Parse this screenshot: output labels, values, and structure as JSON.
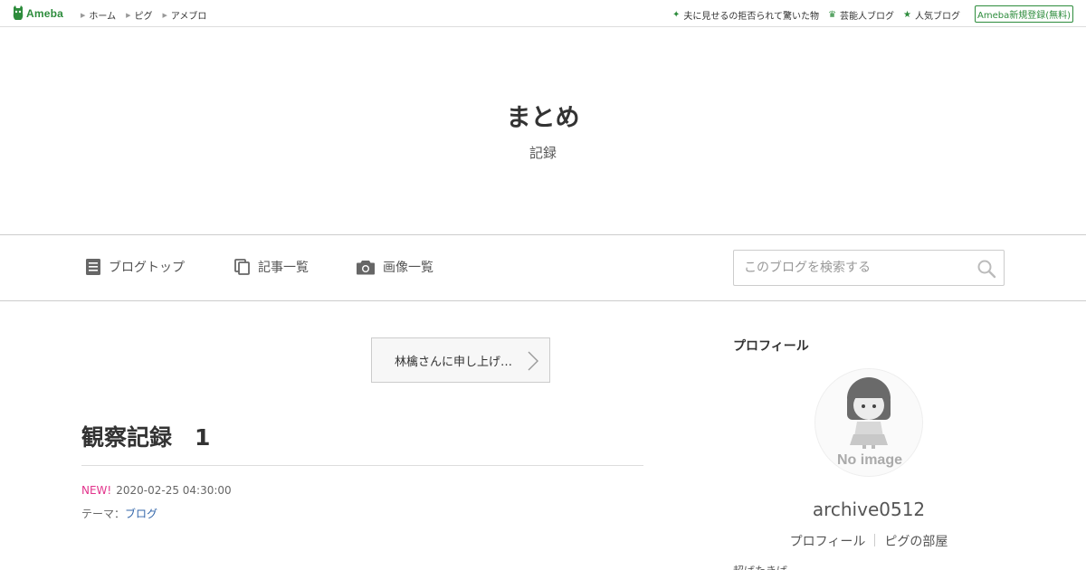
{
  "topbar": {
    "logo_text": "Ameba",
    "nav": [
      {
        "label": "ホーム"
      },
      {
        "label": "ピグ"
      },
      {
        "label": "アメブロ"
      }
    ],
    "right_links": [
      {
        "label": "夫に見せるの拒否られて驚いた物",
        "icon": "sparkle-icon"
      },
      {
        "label": "芸能人ブログ",
        "icon": "crown-icon"
      },
      {
        "label": "人気ブログ",
        "icon": "star-icon"
      }
    ],
    "signup_label": "Ameba新規登録(無料)",
    "accent": "#2d8c3c"
  },
  "header": {
    "title": "まとめ",
    "description": "記録"
  },
  "nav": {
    "items": [
      {
        "label": "ブログトップ",
        "icon": "document-icon"
      },
      {
        "label": "記事一覧",
        "icon": "copy-icon"
      },
      {
        "label": "画像一覧",
        "icon": "camera-icon"
      }
    ],
    "search_placeholder": "このブログを検索する"
  },
  "main": {
    "next_article": "林檎さんに申し上げ…",
    "entry_title": "観察記録　1",
    "new_badge": "NEW!",
    "date": "2020-02-25 04:30:00",
    "theme_label": "テーマ：",
    "theme_link": "ブログ",
    "new_color": "#e2348c"
  },
  "sidebar": {
    "heading": "プロフィール",
    "avatar_text": "No image",
    "username": "archive0512",
    "links": [
      {
        "label": "プロフィール"
      },
      {
        "label": "ピグの部屋"
      }
    ],
    "cut_text": "超ばたきば"
  }
}
